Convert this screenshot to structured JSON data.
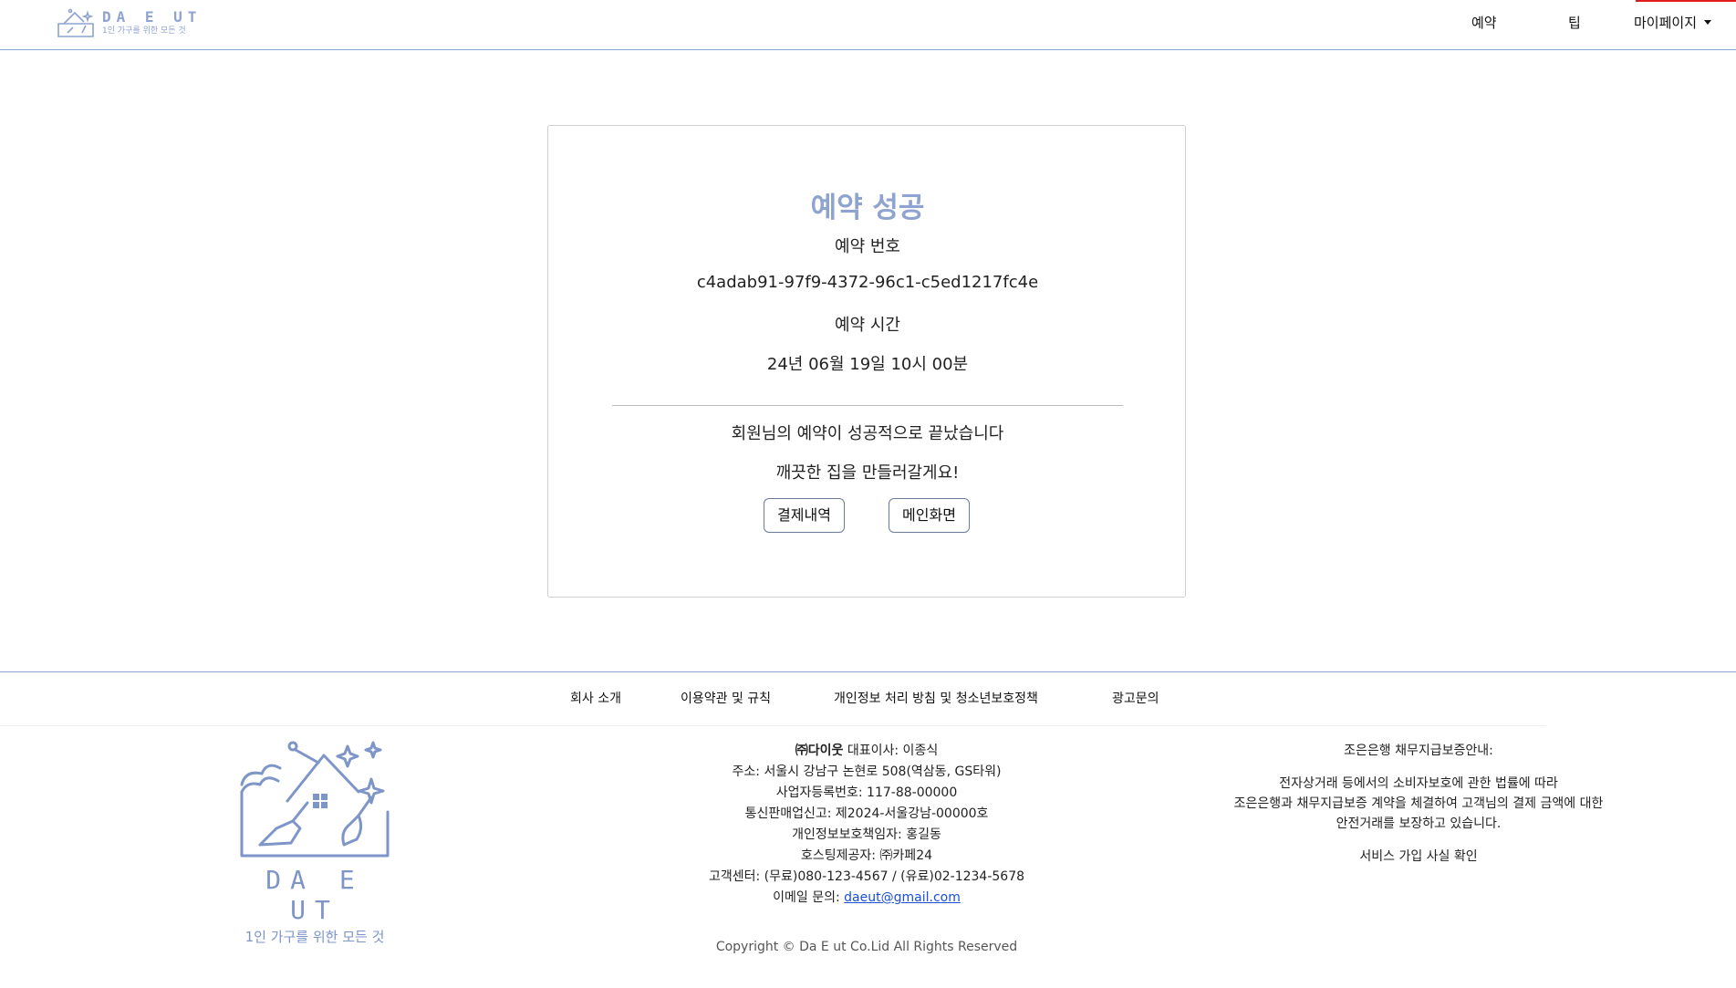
{
  "brand": {
    "name": "DA E UT",
    "tagline": "1인 가구를 위한 모든 것",
    "accent_color": "#8ea3cf"
  },
  "nav": {
    "reserve": "예약",
    "tip": "팁",
    "mypage": "마이페이지"
  },
  "card": {
    "title": "예약 성공",
    "reservation_number_label": "예약 번호",
    "reservation_number": "c4adab91-97f9-4372-96c1-c5ed1217fc4e",
    "reservation_time_label": "예약 시간",
    "reservation_time": "24년 06월 19일 10시 00분",
    "message_1": "회원님의 예약이 성공적으로 끝났습니다",
    "message_2": "깨끗한 집을 만들러갈게요!",
    "payment_button": "결제내역",
    "main_button": "메인화면"
  },
  "footer": {
    "links": [
      "회사 소개",
      "이용약관 및 규칙",
      "개인정보 처리 방침 및 청소년보호정책",
      "광고문의"
    ],
    "company_name": "㈜다이웃",
    "ceo": "대표이사: 이종식",
    "address": "주소: 서울시 강남구 논현로 508(역삼동, GS타워)",
    "business_number": "사업자등록번호: 117-88-00000",
    "mail_order": "통신판매업신고: 제2024-서울강남-00000호",
    "privacy_officer": "개인정보보호책임자: 홍길동",
    "hosting": "호스팅제공자: ㈜카페24",
    "customer_center": "고객센터: (무료)080-123-4567 / (유료)02-1234-5678",
    "email_label": "이메일 문의: ",
    "email": "daeut@gmail.com",
    "guarantee_title": "조은은행 채무지급보증안내:",
    "guarantee_line_1": "전자상거래 등에서의 소비자보호에 관한 법률에 따라",
    "guarantee_line_2": "조은은행과 채무지급보증 계약을 체결하여 고객님의 결제 금액에 대한",
    "guarantee_line_3": "안전거래를 보장하고 있습니다.",
    "service_check": "서비스 가입 사실 확인",
    "copyright": "Copyright © Da E ut Co.Lid All Rights Reserved"
  }
}
